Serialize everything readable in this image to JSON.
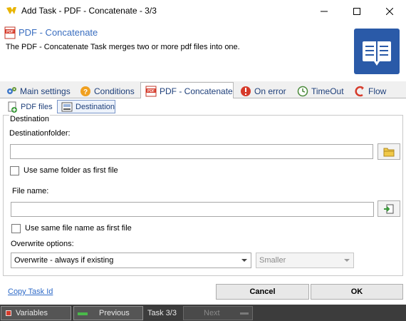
{
  "window": {
    "title": "Add Task - PDF - Concatenate - 3/3",
    "minimize_icon": "minimize-icon",
    "maximize_icon": "maximize-icon",
    "close_icon": "close-icon"
  },
  "header": {
    "heading": "PDF - Concatenate",
    "description": "The PDF - Concatenate Task merges two or more pdf files into one.",
    "heading_color": "#3a6ec0",
    "badge_icon": "book-icon",
    "badge_color": "#2a5aa8"
  },
  "tabs": [
    {
      "label": "Main settings",
      "icon": "gears-icon",
      "active": false
    },
    {
      "label": "Conditions",
      "icon": "question-icon",
      "active": false
    },
    {
      "label": "PDF - Concatenate",
      "icon": "pdf-icon",
      "active": true
    },
    {
      "label": "On error",
      "icon": "error-icon",
      "active": false
    },
    {
      "label": "TimeOut",
      "icon": "timeout-icon",
      "active": false
    },
    {
      "label": "Flow",
      "icon": "flow-icon",
      "active": false
    }
  ],
  "subtabs": [
    {
      "label": "PDF files",
      "icon": "add-file-icon",
      "active": false
    },
    {
      "label": "Destination",
      "icon": "destination-icon",
      "active": true
    }
  ],
  "destination": {
    "group_title": "Destination",
    "folder_label": "Destinationfolder:",
    "folder_value": "",
    "same_folder_label": "Use same folder as first file",
    "same_folder_checked": false,
    "filename_label": "File name:",
    "filename_value": "",
    "same_filename_label": "Use same file name as first file",
    "same_filename_checked": false,
    "overwrite_label": "Overwrite options:",
    "overwrite_selected": "Overwrite - always if existing",
    "size_selected": "Smaller"
  },
  "footer": {
    "copy_link": "Copy Task Id",
    "cancel": "Cancel",
    "ok": "OK"
  },
  "statusbar": {
    "variables": "Variables",
    "previous": "Previous",
    "task": "Task 3/3",
    "next": "Next"
  }
}
